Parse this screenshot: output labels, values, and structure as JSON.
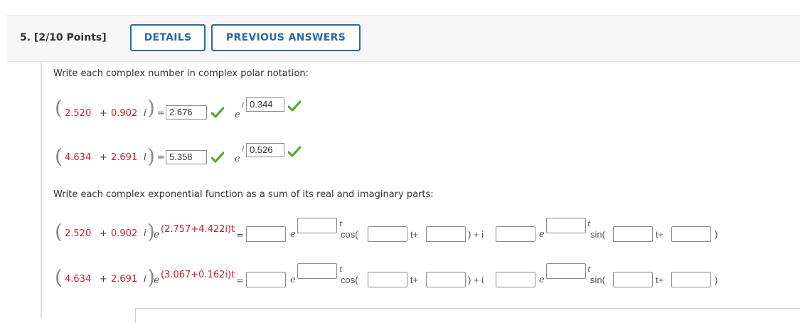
{
  "header": {
    "question": "5. [2/10 Points]",
    "details_label": "DETAILS",
    "previous_label": "PREVIOUS ANSWERS"
  },
  "part1": {
    "prompt": "Write each complex number in complex polar notation:",
    "rows": [
      {
        "re": "2.520",
        "im": "0.902",
        "magnitude": "2.676",
        "angle": "0.344"
      },
      {
        "re": "4.634",
        "im": "2.691",
        "magnitude": "5.358",
        "angle": "0.526"
      }
    ]
  },
  "part2": {
    "prompt": "Write each complex exponential function as a sum of its real and imaginary parts:",
    "rows": [
      {
        "re": "2.520",
        "im": "0.902",
        "exponent": "(2.757+4.422i)t"
      },
      {
        "re": "4.634",
        "im": "2.691",
        "exponent": "(3.067+0.162i)t"
      }
    ]
  },
  "symbols": {
    "plus": "+",
    "i": "i",
    "equals": "=",
    "e": "e",
    "t": "t",
    "cos": "cos(",
    "sin": "sin(",
    "t_plus": "t+",
    "close_plus_i": ") + i",
    "close": ")",
    "exp_e": "e"
  },
  "colors": {
    "accent": "#2a6aa6",
    "answer_red": "#c0272d",
    "check_green": "#5aa832"
  },
  "icons": {
    "correct": "check-icon"
  }
}
